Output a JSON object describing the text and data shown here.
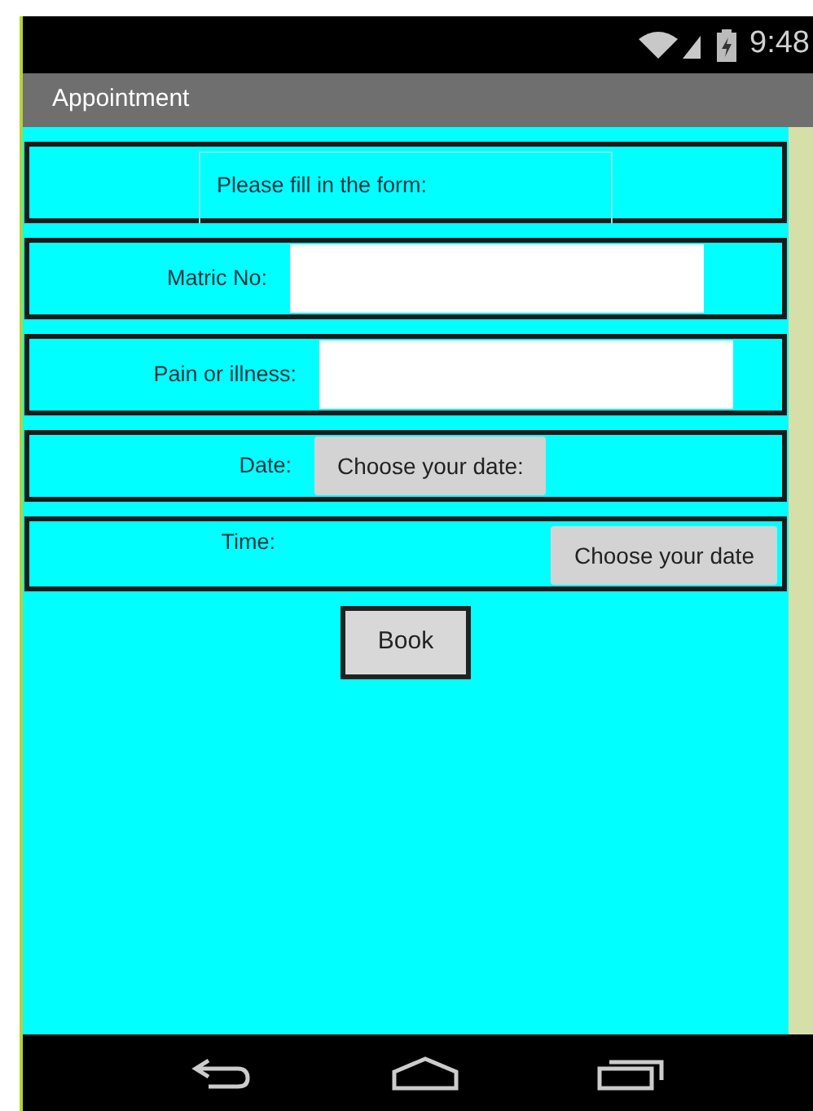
{
  "status_bar": {
    "time": "9:48"
  },
  "title_bar": {
    "title": "Appointment"
  },
  "form": {
    "heading": "Please fill in the form:",
    "rows": [
      {
        "kind": "text",
        "label": "Matric No:"
      },
      {
        "kind": "text",
        "label": "Pain or illness:"
      },
      {
        "kind": "picker",
        "label": "Date:",
        "button": "Choose your date:"
      },
      {
        "kind": "picker-right",
        "label": "Time:",
        "button": "Choose your date"
      }
    ],
    "submit": "Book"
  }
}
